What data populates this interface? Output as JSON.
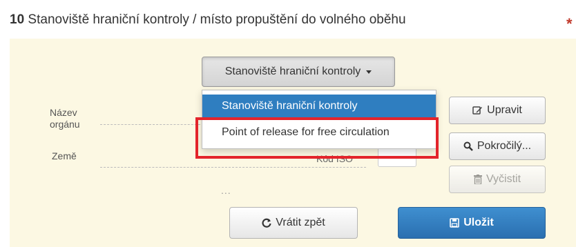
{
  "section": {
    "number": "10",
    "title": "Stanoviště hraniční kontroly / místo propuštění do volného oběhu",
    "required_marker": "*"
  },
  "fields": {
    "authority_name_label": "Název\norgánu",
    "country_label": "Země",
    "iso_code_label": "Kód ISO",
    "ellipsis": "..."
  },
  "dropdown": {
    "toggle_label": "Stanoviště hraniční kontroly",
    "options": [
      {
        "label": "Stanoviště hraniční kontroly",
        "selected": true
      },
      {
        "label": "Point of release for free circulation",
        "selected": false
      }
    ]
  },
  "actions": {
    "edit_label": "Upravit",
    "advanced_label": "Pokročilý...",
    "clear_label": "Vyčistit",
    "revert_label": "Vrátit zpět",
    "save_label": "Uložit"
  },
  "icons": {
    "edit": "pencil-square-icon",
    "advanced": "search-icon",
    "clear": "trash-icon",
    "revert": "undo-icon",
    "save": "floppy-disk-icon"
  },
  "colors": {
    "panel_bg": "#fcf8e3",
    "accent": "#2f7ec0",
    "highlight": "#e3242b",
    "required": "#c0392b"
  }
}
